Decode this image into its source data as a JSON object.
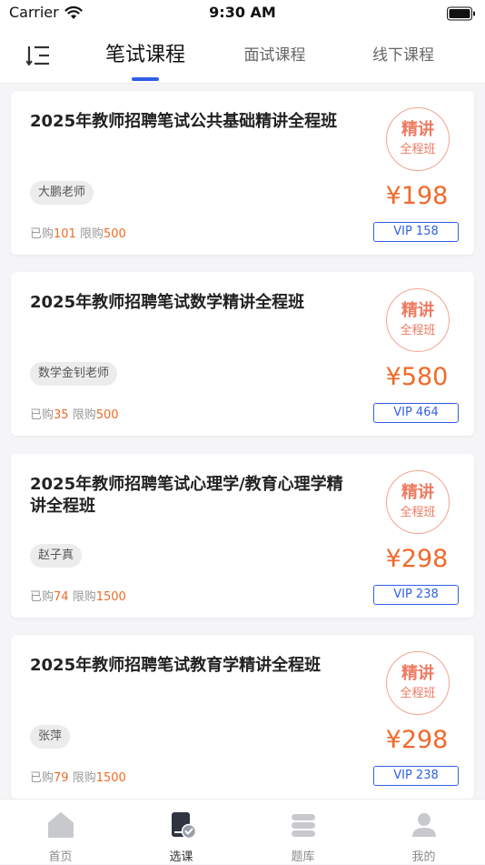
{
  "status_bar": {
    "carrier": "Carrier",
    "time": "9:30 AM"
  },
  "nav": {
    "tabs": [
      {
        "label": "笔试课程",
        "active": true
      },
      {
        "label": "面试课程",
        "active": false
      },
      {
        "label": "线下课程",
        "active": false
      }
    ],
    "accent_color": "#2f5fe8"
  },
  "courses": [
    {
      "title": "2025年教师招聘笔试公共基础精讲全程班",
      "teacher": "大鹏老师",
      "bought_label": "已购",
      "bought": "101",
      "limit_label": "限购",
      "limit": "500",
      "stamp_line1": "精讲",
      "stamp_line2": "全程班",
      "price": "¥198",
      "vip_price": "VIP 158"
    },
    {
      "title": "2025年教师招聘笔试数学精讲全程班",
      "teacher": "数学金钊老师",
      "bought_label": "已购",
      "bought": "35",
      "limit_label": "限购",
      "limit": "500",
      "stamp_line1": "精讲",
      "stamp_line2": "全程班",
      "price": "¥580",
      "vip_price": "VIP 464"
    },
    {
      "title": "2025年教师招聘笔试心理学/教育心理学精讲全程班",
      "teacher": "赵子真",
      "bought_label": "已购",
      "bought": "74",
      "limit_label": "限购",
      "limit": "1500",
      "stamp_line1": "精讲",
      "stamp_line2": "全程班",
      "price": "¥298",
      "vip_price": "VIP 238"
    },
    {
      "title": "2025年教师招聘笔试教育学精讲全程班",
      "teacher": "张萍",
      "bought_label": "已购",
      "bought": "79",
      "limit_label": "限购",
      "limit": "1500",
      "stamp_line1": "精讲",
      "stamp_line2": "全程班",
      "price": "¥298",
      "vip_price": "VIP 238"
    }
  ],
  "tabbar": {
    "items": [
      {
        "label": "首页",
        "icon": "home-icon",
        "active": false
      },
      {
        "label": "选课",
        "icon": "course-select-icon",
        "active": true
      },
      {
        "label": "题库",
        "icon": "question-bank-icon",
        "active": false
      },
      {
        "label": "我的",
        "icon": "profile-icon",
        "active": false
      }
    ]
  },
  "colors": {
    "price": "#f06a2a",
    "vip": "#2f5fe8",
    "stamp": "#ee7a60"
  }
}
